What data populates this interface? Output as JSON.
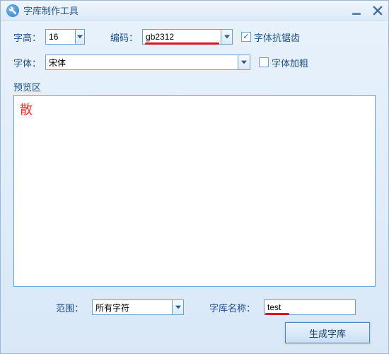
{
  "titlebar": {
    "title": "字库制作工具"
  },
  "row1": {
    "height_label": "字高：",
    "height_value": "16",
    "encoding_label": "编码：",
    "encoding_value": "gb2312",
    "antialias_label": "字体抗锯齿",
    "antialias_checked": true
  },
  "row2": {
    "font_label": "字体：",
    "font_value": "宋体",
    "bold_label": "字体加粗",
    "bold_checked": false
  },
  "preview": {
    "section_label": "预览区",
    "sample_char": "散"
  },
  "bottom": {
    "range_label": "范围：",
    "range_value": "所有字符",
    "libname_label": "字库名称：",
    "libname_value": "test",
    "generate_label": "生成字库"
  }
}
